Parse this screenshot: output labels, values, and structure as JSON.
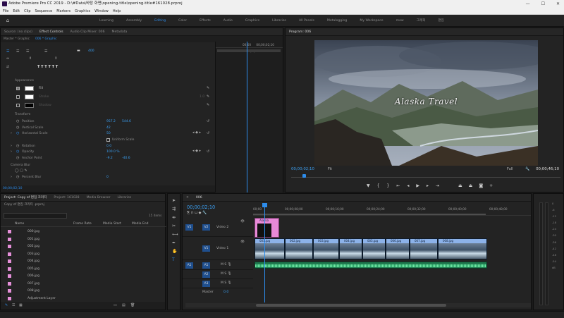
{
  "title": "Adobe Premiere Pro CC 2019 - D:\\#Data\\바탕 화면\\opening-title\\opening-title#161028.prproj",
  "window_buttons": [
    "—",
    "☐",
    "✕"
  ],
  "menu": [
    "File",
    "Edit",
    "Clip",
    "Sequence",
    "Markers",
    "Graphics",
    "Window",
    "Help"
  ],
  "workspaces": [
    "Learning",
    "Assembly",
    "Editing",
    "Color",
    "Effects",
    "Audio",
    "Graphics",
    "Libraries",
    "All Panels",
    "Metalogging",
    "My Workspace",
    "mow",
    "그래픽",
    "편집"
  ],
  "active_workspace": "Editing",
  "effect_controls": {
    "tabs": [
      "Source: (no clips)",
      "Effect Controls",
      "Audio Clip Mixer: 006",
      "Metadata"
    ],
    "active_tab": "Effect Controls",
    "master": "Master * Graphic",
    "clip": "006 * Graphic",
    "font_size_value": "400",
    "appearance_label": "Appearance",
    "fill": "Fill",
    "stroke": "Stroke",
    "stroke_value": "1.0",
    "shadow": "Shadow",
    "transform_label": "Transform",
    "position_label": "Position",
    "position_x": "957.2",
    "position_y": "544.6",
    "vscale_label": "Vertical Scale",
    "vscale": "42",
    "hscale_label": "Horizontal Scale",
    "hscale": "50",
    "uniform_label": "Uniform Scale",
    "rotation_label": "Rotation",
    "rotation": "0.0",
    "opacity_label": "Opacity",
    "opacity": "100.0 %",
    "anchor_label": "Anchor Point",
    "anchor_x": "-9.2",
    "anchor_y": "-40.6",
    "camera_blur_label": "Camera Blur",
    "percent_blur_label": "Percent Blur",
    "percent_blur": "0",
    "timecode": "00;00;02;10",
    "ruler_start": "00;00",
    "ruler_mid": "00;00;02;10",
    "ruler_end": "00;0("
  },
  "program": {
    "title": "Program: 006",
    "video_text": "Alaska Travel",
    "timecode": "00;00;02;10",
    "fit": "Fit",
    "quality": "Full",
    "duration": "00;00;46;10"
  },
  "project": {
    "tabs": [
      "Project: Copy of 편집 크리티",
      "Project: 161028",
      "Media Browser",
      "Libraries"
    ],
    "subtitle": "Copy of 편집 크리티 .prproj",
    "items_count": "15 items",
    "columns": [
      "Name",
      "Frame Rate",
      "Media Start",
      "Media End"
    ],
    "files": [
      "000.jpg",
      "001.jpg",
      "002.jpg",
      "003.jpg",
      "004.jpg",
      "005.jpg",
      "006.jpg",
      "007.jpg",
      "008.jpg",
      "Adjustment Layer"
    ]
  },
  "timeline": {
    "sequence": "006",
    "timecode": "00;00;02;10",
    "ruler": [
      "00;00",
      "00;00;08;00",
      "00;00;16;00",
      "00;00;24;00",
      "00;00;32;00",
      "00;00;40;00",
      "00;00;48;00"
    ],
    "tracks": {
      "v2_name": "Video 2",
      "v1_name": "Video 1",
      "v2": "V2",
      "v1": "V1",
      "a1": "A1",
      "a2": "A2",
      "a3": "A3",
      "src_v": "V1",
      "src_a": "A1",
      "master": "Master",
      "master_value": "0.0"
    },
    "graphic_clip": "Alaska",
    "video_clips": [
      "001.jpg",
      "002.jpg",
      "003.jpg",
      "004.jpg",
      "005.jpg",
      "006.jpg",
      "007.jpg",
      "008.jpg"
    ]
  },
  "meter_scale": [
    "0",
    "-6",
    "-12",
    "-18",
    "-24",
    "-30",
    "-36",
    "-42",
    "-48",
    "-54",
    "dB"
  ]
}
